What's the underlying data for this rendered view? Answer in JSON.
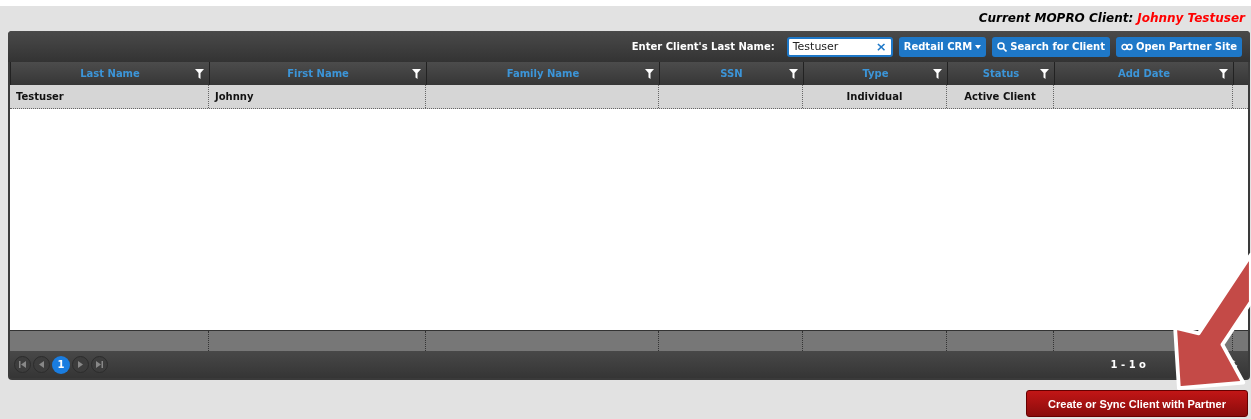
{
  "header": {
    "label": "Current MOPRO Client:",
    "client_name": "Johnny Testuser"
  },
  "toolbar": {
    "label": "Enter Client's Last Name:",
    "search_field": {
      "value": "Testuser",
      "clear": "×"
    },
    "crm_dropdown": "Redtail CRM",
    "buttons": [
      {
        "kind": "search",
        "label": "Search for Client"
      },
      {
        "kind": "link",
        "label": "Open Partner Site"
      }
    ]
  },
  "table": {
    "columns": [
      {
        "label": "Last Name",
        "filter": true
      },
      {
        "label": "First Name",
        "filter": true
      },
      {
        "label": "Family Name",
        "filter": true
      },
      {
        "label": "SSN",
        "filter": true
      },
      {
        "label": "Type",
        "filter": true
      },
      {
        "label": "Status",
        "filter": true
      },
      {
        "label": "Add Date",
        "filter": true
      }
    ],
    "rows": [
      [
        "Testuser",
        "Johnny",
        "",
        "",
        "Individual",
        "Active Client",
        ""
      ]
    ]
  },
  "pager": {
    "pages": [
      {
        "label": "1",
        "selected": true
      }
    ],
    "info": "1 - 1 o"
  },
  "action_button": "Create or Sync Client with Partner"
}
